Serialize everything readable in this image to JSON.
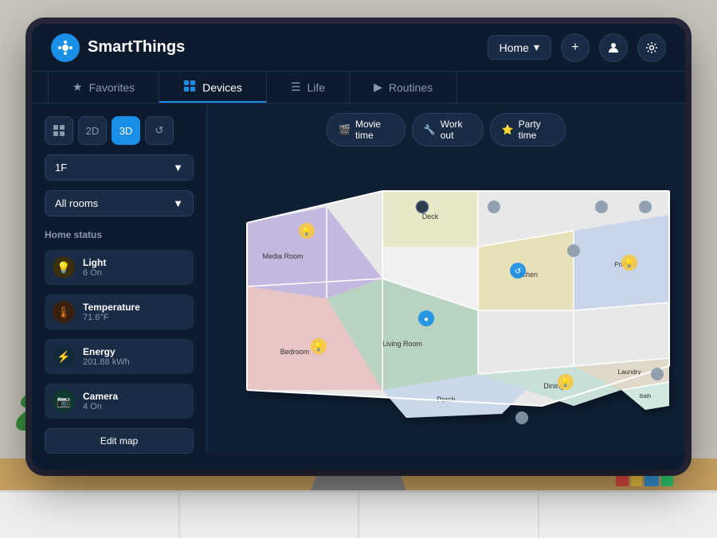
{
  "app": {
    "name": "SmartThings",
    "logo_symbol": "✦"
  },
  "header": {
    "home_label": "Home",
    "add_label": "+",
    "profile_icon": "person",
    "settings_icon": "gear"
  },
  "nav": {
    "tabs": [
      {
        "id": "favorites",
        "label": "Favorites",
        "icon": "★",
        "active": false
      },
      {
        "id": "devices",
        "label": "Devices",
        "icon": "⊞",
        "active": true
      },
      {
        "id": "life",
        "label": "Life",
        "icon": "☰",
        "active": false
      },
      {
        "id": "routines",
        "label": "Routines",
        "icon": "▶",
        "active": false
      }
    ]
  },
  "sidebar": {
    "view_buttons": [
      {
        "id": "grid",
        "label": "⊞",
        "active": false
      },
      {
        "id": "2d",
        "label": "2D",
        "active": false
      },
      {
        "id": "3d",
        "label": "3D",
        "active": true
      },
      {
        "id": "history",
        "label": "↺",
        "active": false
      }
    ],
    "floor_select": {
      "value": "1F",
      "arrow": "▼"
    },
    "room_select": {
      "value": "All rooms",
      "arrow": "▼"
    },
    "home_status_title": "Home status",
    "status_items": [
      {
        "id": "light",
        "name": "Light",
        "value": "6 On",
        "icon": "💡",
        "type": "yellow"
      },
      {
        "id": "temperature",
        "name": "Temperature",
        "value": "71.6°F",
        "icon": "🌡",
        "type": "orange"
      },
      {
        "id": "energy",
        "name": "Energy",
        "value": "201.88 kWh",
        "icon": "⚡",
        "type": "blue"
      },
      {
        "id": "camera",
        "name": "Camera",
        "value": "4 On",
        "icon": "📷",
        "type": "teal"
      }
    ],
    "edit_map_label": "Edit map"
  },
  "scenes": [
    {
      "id": "movie",
      "label": "Movie time",
      "icon": "🎬"
    },
    {
      "id": "workout",
      "label": "Work out",
      "icon": "🔧"
    },
    {
      "id": "party",
      "label": "Party time",
      "icon": "⭐"
    }
  ],
  "colors": {
    "bg_dark": "#0d1b2e",
    "accent_blue": "#1a8fe8",
    "sidebar_item": "#1a2b45",
    "text_muted": "#8899aa",
    "active_tab_line": "#1a8fe8"
  }
}
